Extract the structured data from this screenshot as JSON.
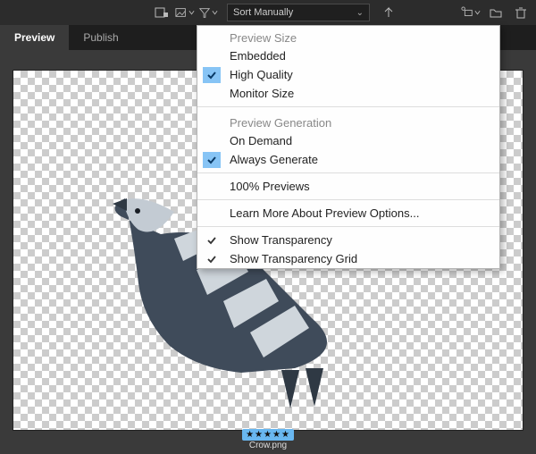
{
  "toolbar": {
    "sort_label": "Sort Manually"
  },
  "tabs": [
    {
      "label": "Preview",
      "active": true
    },
    {
      "label": "Publish",
      "active": false
    }
  ],
  "menu": {
    "section_preview_size": "Preview Size",
    "embedded": "Embedded",
    "high_quality": "High Quality",
    "monitor_size": "Monitor Size",
    "section_preview_generation": "Preview Generation",
    "on_demand": "On Demand",
    "always_generate": "Always Generate",
    "hundred_previews": "100% Previews",
    "learn_more": "Learn More About Preview Options...",
    "show_transparency": "Show Transparency",
    "show_transparency_grid": "Show Transparency Grid"
  },
  "file": {
    "name": "Crow.png",
    "rating": "★★★★★"
  }
}
